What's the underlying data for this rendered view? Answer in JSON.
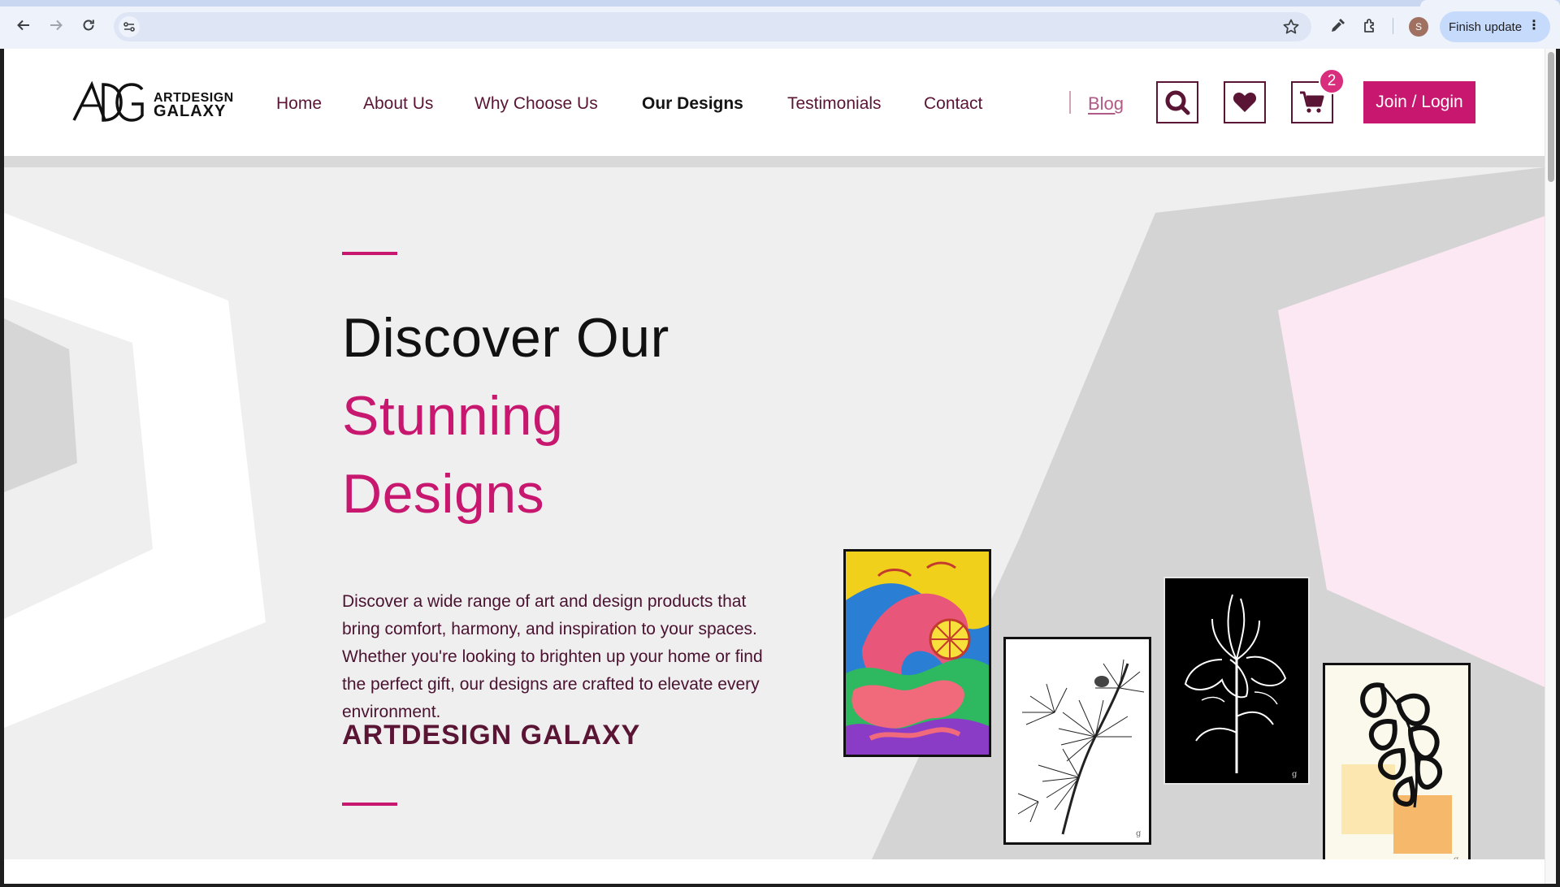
{
  "browser": {
    "finish_update_label": "Finish update",
    "profile_initial": "S"
  },
  "brand": {
    "monogram": "ADG",
    "line1": "ARTDESIGN",
    "line2": "GALAXY"
  },
  "nav": {
    "items": [
      {
        "label": "Home"
      },
      {
        "label": "About Us"
      },
      {
        "label": "Why Choose Us"
      },
      {
        "label": "Our Designs"
      },
      {
        "label": "Testimonials"
      },
      {
        "label": "Contact"
      }
    ],
    "blog_label": "Blog",
    "cart_count": "2",
    "login_label": "Join / Login"
  },
  "hero": {
    "title_line1": "Discover Our",
    "title_line2": "Stunning",
    "title_line3": "Designs",
    "description": "Discover a wide range of art and design products that bring comfort, harmony, and inspiration to your spaces. Whether you're looking to brighten up your home or find the perfect gift, our designs are crafted to elevate every environment.",
    "brand": "ARTDESIGN GALAXY"
  },
  "colors": {
    "accent": "#c7176f",
    "deep": "#5a1535",
    "chrome": "#eef2fb"
  },
  "icons": [
    "back-icon",
    "forward-icon",
    "reload-icon",
    "site-info-icon",
    "bookmark-star-icon",
    "eyedropper-icon",
    "extensions-icon",
    "search-icon",
    "heart-icon",
    "cart-icon"
  ]
}
